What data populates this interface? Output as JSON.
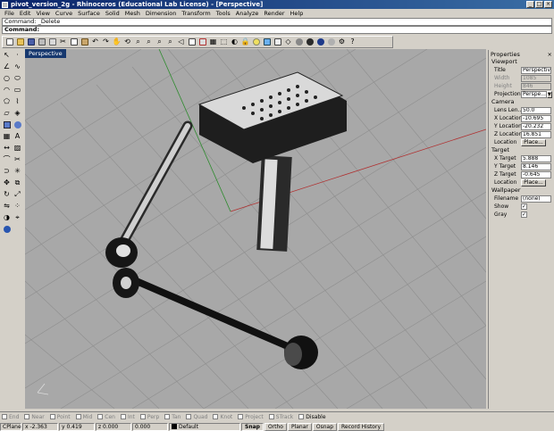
{
  "window": {
    "title": "pivot_version_2g - Rhinoceros (Educational Lab License) - [Perspective]"
  },
  "menus": [
    "File",
    "Edit",
    "View",
    "Curve",
    "Surface",
    "Solid",
    "Mesh",
    "Dimension",
    "Transform",
    "Tools",
    "Analyze",
    "Render",
    "Help"
  ],
  "command": {
    "history": "Command: _Delete",
    "prompt": "Command:"
  },
  "viewport": {
    "label": "Perspective"
  },
  "properties": {
    "title": "Properties",
    "viewport_section": "Viewport",
    "title_label": "Title",
    "title_value": "Perspective",
    "width_label": "Width",
    "width_value": "1085",
    "height_label": "Height",
    "height_value": "846",
    "projection_label": "Projection",
    "projection_value": "Perspe...",
    "camera_section": "Camera",
    "lens_label": "Lens Len...",
    "lens_value": "50.0",
    "xloc_label": "X Location",
    "xloc_value": "-10.695",
    "yloc_label": "Y Location",
    "yloc_value": "-20.232",
    "zloc_label": "Z Location",
    "zloc_value": "16.851",
    "location_label": "Location",
    "place_label": "Place...",
    "target_section": "Target",
    "tx_label": "X Target",
    "tx_value": "5.888",
    "ty_label": "Y Target",
    "ty_value": "8.146",
    "tz_label": "Z Target",
    "tz_value": "-0.645",
    "tloc_label": "Location",
    "tplace_label": "Place...",
    "wallpaper_section": "Wallpaper",
    "filename_label": "Filename",
    "filename_value": "(none)",
    "show_label": "Show",
    "gray_label": "Gray"
  },
  "osnaps": [
    {
      "label": "End",
      "on": false
    },
    {
      "label": "Near",
      "on": false
    },
    {
      "label": "Point",
      "on": false
    },
    {
      "label": "Mid",
      "on": false
    },
    {
      "label": "Cen",
      "on": false
    },
    {
      "label": "Int",
      "on": false
    },
    {
      "label": "Perp",
      "on": false
    },
    {
      "label": "Tan",
      "on": false
    },
    {
      "label": "Quad",
      "on": false
    },
    {
      "label": "Knot",
      "on": false
    },
    {
      "label": "Project",
      "on": false
    },
    {
      "label": "STrack",
      "on": false
    },
    {
      "label": "Disable",
      "on": true
    }
  ],
  "status": {
    "cplane": "CPlane",
    "x": "x -2.363",
    "y": "y 0.419",
    "z": "z 0.000",
    "dist": "0.000",
    "layer": "Default",
    "buttons": [
      {
        "label": "Snap",
        "on": true
      },
      {
        "label": "Ortho",
        "on": false
      },
      {
        "label": "Planar",
        "on": false
      },
      {
        "label": "Osnap",
        "on": false
      },
      {
        "label": "Record History",
        "on": false
      }
    ]
  },
  "colors": {
    "title_start": "#0a246a",
    "title_end": "#3a6ea5",
    "viewport_bg": "#a8a8a8",
    "vp_label_bg": "#16386e",
    "grid_red": "#b03030",
    "grid_green": "#2e8b2e"
  }
}
